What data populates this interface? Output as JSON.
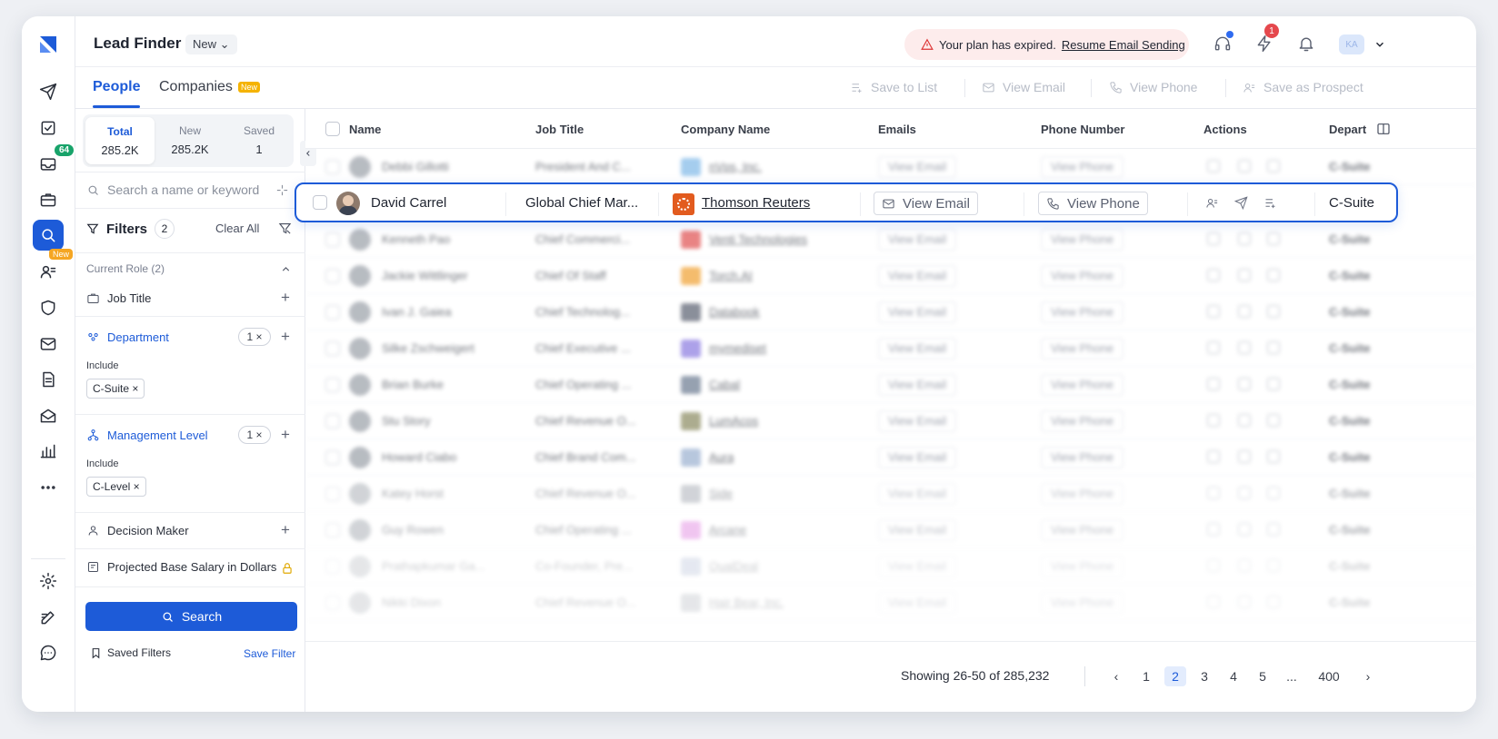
{
  "app": {
    "title": "Lead Finder",
    "view_mode": "New",
    "accent": "#1d5bd8"
  },
  "rail": {
    "badge_inbox": "64",
    "badge_new": "New"
  },
  "header": {
    "alert_text": "Your plan has expired.",
    "alert_link": "Resume Email Sending",
    "notif_count": "1",
    "avatar_initials": "KA"
  },
  "tabs": [
    {
      "label": "People"
    },
    {
      "label": "Companies",
      "tag": "New"
    }
  ],
  "toolbar": {
    "save_to_list": "Save to List",
    "view_email": "View Email",
    "view_phone": "View Phone",
    "save_prospect": "Save as Prospect"
  },
  "segments": [
    {
      "label": "Total",
      "value": "285.2K"
    },
    {
      "label": "New",
      "value": "285.2K"
    },
    {
      "label": "Saved",
      "value": "1"
    }
  ],
  "filters": {
    "search_placeholder": "Search a name or keyword",
    "title": "Filters",
    "count": "2",
    "clear_all": "Clear All",
    "current_role": "Current Role (2)",
    "job_title": "Job Title",
    "department": "Department",
    "department_count": "1 ×",
    "include": "Include",
    "department_chip": "C-Suite ×",
    "management_level": "Management Level",
    "management_count": "1 ×",
    "management_chip": "C-Level ×",
    "decision_maker": "Decision Maker",
    "salary": "Projected Base Salary in Dollars",
    "search_btn": "Search",
    "saved_filters": "Saved Filters",
    "save_filter": "Save Filter"
  },
  "columns": [
    "Name",
    "Job Title",
    "Company Name",
    "Emails",
    "Phone Number",
    "Actions",
    "Depart"
  ],
  "rows": [
    {
      "name": "Debbi Gillotti",
      "title": "President And C...",
      "company": "nVps, Inc.",
      "email": "View Email",
      "phone": "View Phone",
      "dept": "C-Suite"
    },
    {
      "name": "David Carrel",
      "title": "Global Chief Mar...",
      "company": "Thomson Reuters",
      "email": "View Email",
      "phone": "View Phone",
      "dept": "C-Suite"
    },
    {
      "name": "Kenneth Pao",
      "title": "Chief Commerci...",
      "company": "Venti Technologies",
      "email": "View Email",
      "phone": "View Phone",
      "dept": "C-Suite"
    },
    {
      "name": "Jackie Wittlinger",
      "title": "Chief Of Staff",
      "company": "Torch.AI",
      "email": "View Email",
      "phone": "View Phone",
      "dept": "C-Suite"
    },
    {
      "name": "Ivan J. Gaiea",
      "title": "Chief Technolog...",
      "company": "Databook",
      "email": "View Email",
      "phone": "View Phone",
      "dept": "C-Suite"
    },
    {
      "name": "Silke Zschweigert",
      "title": "Chief Executive ...",
      "company": "mymediset",
      "email": "View Email",
      "phone": "View Phone",
      "dept": "C-Suite"
    },
    {
      "name": "Brian Burke",
      "title": "Chief Operating ...",
      "company": "Cabal",
      "email": "View Email",
      "phone": "View Phone",
      "dept": "C-Suite"
    },
    {
      "name": "Stu Story",
      "title": "Chief Revenue O...",
      "company": "LumAcos",
      "email": "View Email",
      "phone": "View Phone",
      "dept": "C-Suite"
    },
    {
      "name": "Howard Ciabo",
      "title": "Chief Brand Com...",
      "company": "Aura",
      "email": "View Email",
      "phone": "View Phone",
      "dept": "C-Suite"
    },
    {
      "name": "Katey Horst",
      "title": "Chief Revenue O...",
      "company": "Side",
      "email": "View Email",
      "phone": "View Phone",
      "dept": "C-Suite"
    },
    {
      "name": "Guy Rowen",
      "title": "Chief Operating ...",
      "company": "Arcane",
      "email": "View Email",
      "phone": "View Phone",
      "dept": "C-Suite"
    },
    {
      "name": "Prathapkumar Ga...",
      "title": "Co-Founder, Pre...",
      "company": "QualDeal",
      "email": "View Email",
      "phone": "View Phone",
      "dept": "C-Suite"
    },
    {
      "name": "Nikki Dixon",
      "title": "Chief Revenue O...",
      "company": "Hair Bear, Inc.",
      "email": "View Email",
      "phone": "View Phone",
      "dept": "C-Suite"
    }
  ],
  "pagination": {
    "showing": "Showing  26-50 of 285,232",
    "pages": [
      "1",
      "2",
      "3",
      "4",
      "5",
      "...",
      "400"
    ],
    "current": "2"
  }
}
